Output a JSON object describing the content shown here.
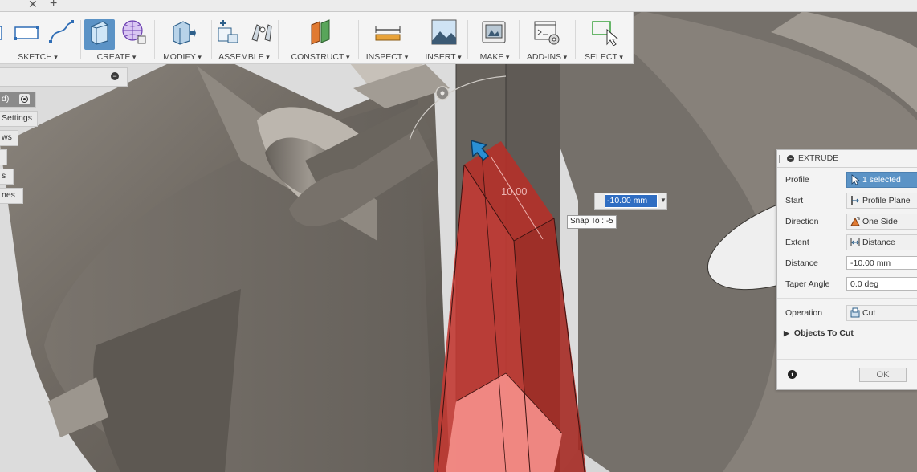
{
  "tabs": {
    "close_glyph": "✕",
    "add_glyph": "+"
  },
  "toolbar": {
    "groups": [
      {
        "label": "SKETCH"
      },
      {
        "label": "CREATE",
        "active": true
      },
      {
        "label": "MODIFY"
      },
      {
        "label": "ASSEMBLE"
      },
      {
        "label": "CONSTRUCT"
      },
      {
        "label": "INSPECT"
      },
      {
        "label": "INSERT"
      },
      {
        "label": "MAKE"
      },
      {
        "label": "ADD-INS"
      },
      {
        "label": "SELECT"
      }
    ]
  },
  "browser": {
    "collapse_glyph": "−",
    "items": [
      {
        "label": "d)"
      },
      {
        "label": "Settings"
      },
      {
        "label": "ws"
      },
      {
        "label": ""
      },
      {
        "label": "s"
      },
      {
        "label": "nes"
      }
    ]
  },
  "canvas": {
    "dimension_label": "10.00",
    "distance_input_value": "-10.00 mm",
    "snap_tooltip": "Snap To : -5"
  },
  "extrude_dialog": {
    "title": "EXTRUDE",
    "profile": {
      "label": "Profile",
      "value": "1 selected"
    },
    "start": {
      "label": "Start",
      "value": "Profile Plane"
    },
    "direction": {
      "label": "Direction",
      "value": "One Side"
    },
    "extent": {
      "label": "Extent",
      "value": "Distance"
    },
    "distance": {
      "label": "Distance",
      "value": "-10.00 mm"
    },
    "taper_angle": {
      "label": "Taper Angle",
      "value": "0.0 deg"
    },
    "operation": {
      "label": "Operation",
      "value": "Cut"
    },
    "objects_to_cut": "Objects To Cut",
    "ok_label": "OK"
  },
  "colors": {
    "cut_body": "#c0392b",
    "accent": "#5b93c6",
    "part": "#6e6860"
  }
}
